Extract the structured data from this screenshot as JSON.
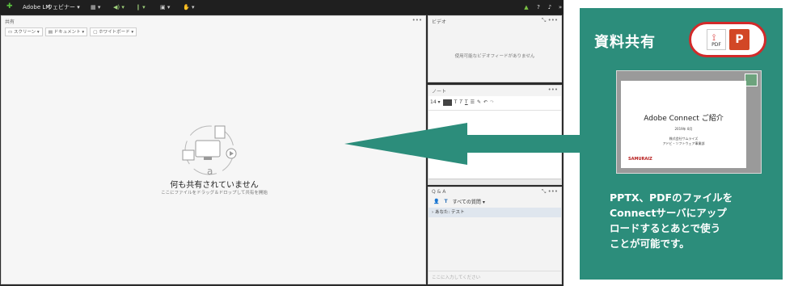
{
  "app": {
    "name": "Adobe LM",
    "menu": "ウェビナー",
    "status_icons": [
      "signal-icon",
      "help-icon",
      "bell-icon"
    ]
  },
  "share_pod": {
    "title": "共有",
    "tools": [
      "スクリーン",
      "ドキュメント",
      "ホワイトボード"
    ],
    "empty_title": "何も共有されていません",
    "empty_subtitle": "ここにファイルをドラッグ＆ドロップして共有を開始"
  },
  "video_pod": {
    "title": "ビデオ",
    "message": "使用可能なビデオフィードがありません"
  },
  "note_pod": {
    "title": "ノート",
    "font_size": "14"
  },
  "qa_pod": {
    "title": "Q & A",
    "filter": "すべての質問",
    "row": "あなた: テスト",
    "input_placeholder": "ここに入力してください"
  },
  "callout": {
    "title": "資料共有",
    "pdf_label": "PDF",
    "ppt_label": "P",
    "slide_title": "Adobe Connect ご紹介",
    "slide_date": "2019年 8月",
    "slide_org1": "株式会社サムライズ",
    "slide_org2": "アドビ・ソフトウェア事業部",
    "slide_logo": "SAMURAIZ",
    "description": [
      "PPTX、PDFのファイルを",
      "Connectサーバにアップ",
      "ロードするとあとで使う",
      "ことが可能です。"
    ],
    "colors": {
      "panel": "#2c8d7b",
      "accent": "#d22a2a"
    }
  }
}
